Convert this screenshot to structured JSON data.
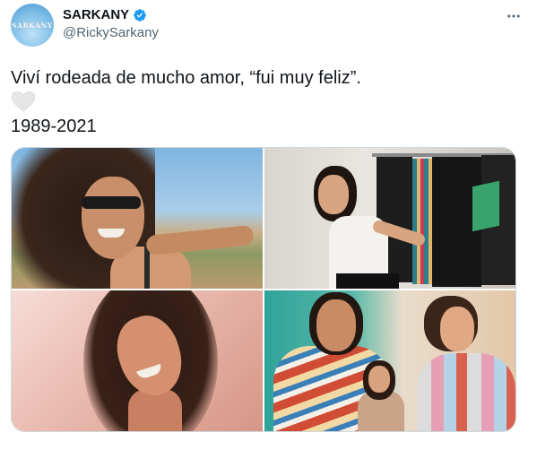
{
  "account": {
    "avatar_text": "SARKANY",
    "display_name": "SARKANY",
    "handle": "@RickySarkany",
    "verified": true
  },
  "tweet": {
    "text": "Viví rodeada de mucho amor, “fui muy feliz”.",
    "emoji": "white-heart-icon",
    "years": "1989-2021"
  },
  "media": {
    "photo_count": 4,
    "photos": [
      "beach-selfie",
      "closet",
      "pink-selfie",
      "mural"
    ]
  },
  "colors": {
    "text": "#0f1419",
    "secondary_text": "#536471",
    "verified": "#1d9bf0",
    "border": "#cfd9de"
  }
}
